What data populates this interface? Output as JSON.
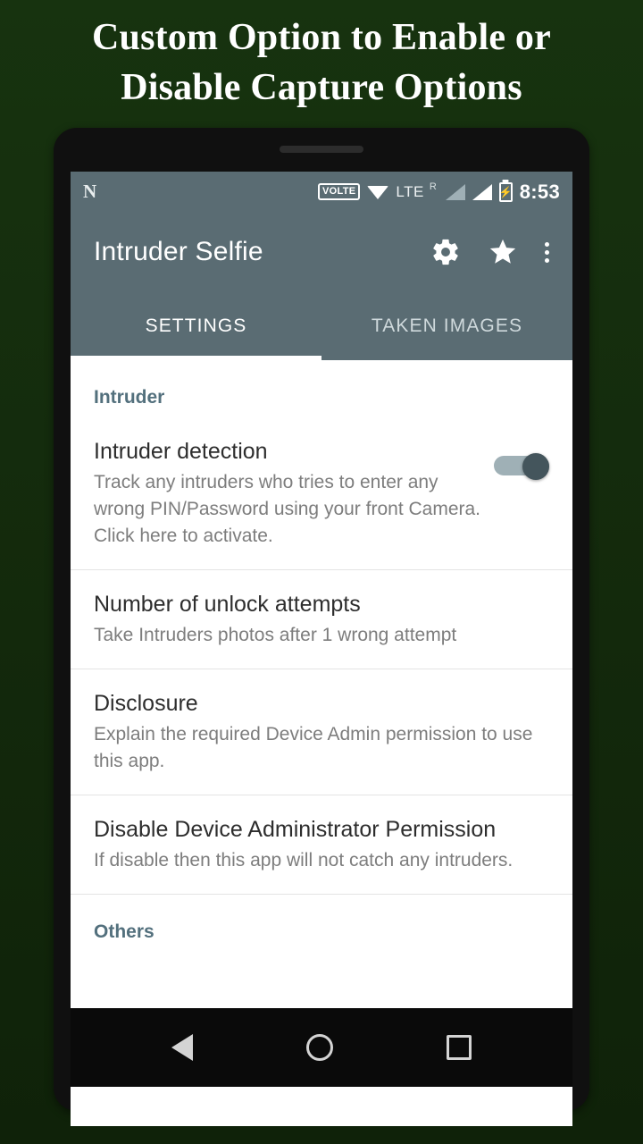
{
  "promo": {
    "headline_line1": "Custom Option to Enable or",
    "headline_line2": "Disable Capture Options"
  },
  "statusbar": {
    "n_logo": "N",
    "volte_badge": "VOLTE",
    "wifi_icon": "wifi-icon",
    "lte_label": "LTE",
    "roaming_label": "R",
    "signal_icon_1": "signal-bars-icon",
    "signal_icon_2": "signal-bars-icon",
    "battery_icon": "battery-charging-icon",
    "battery_glyph": "⚡",
    "clock": "8:53"
  },
  "appbar": {
    "title": "Intruder Selfie",
    "settings_icon": "gear-icon",
    "favorite_icon": "star-icon",
    "overflow_icon": "kebab-menu-icon"
  },
  "tabs": [
    {
      "label": "SETTINGS",
      "active": true
    },
    {
      "label": "TAKEN IMAGES",
      "active": false
    }
  ],
  "settings": {
    "section_intruder": "Intruder",
    "section_others": "Others",
    "items": [
      {
        "title": "Intruder detection",
        "subtitle": "Track any intruders who tries to enter any wrong PIN/Password using your front Camera. Click here to activate.",
        "has_switch": true,
        "switch_on": true
      },
      {
        "title": "Number of unlock attempts",
        "subtitle": "Take Intruders photos after 1 wrong attempt",
        "has_switch": false
      },
      {
        "title": "Disclosure",
        "subtitle": "Explain the required Device Admin permission to use this app.",
        "has_switch": false
      },
      {
        "title": "Disable Device Administrator Permission",
        "subtitle": "If disable then this app will not catch any intruders.",
        "has_switch": false
      }
    ]
  },
  "navbar": {
    "back": "back-button",
    "home": "home-button",
    "recents": "recents-button"
  },
  "colors": {
    "background": "#16300f",
    "appbar": "#5a6c73",
    "accent": "#53707d",
    "switch_thumb": "#44555c"
  }
}
